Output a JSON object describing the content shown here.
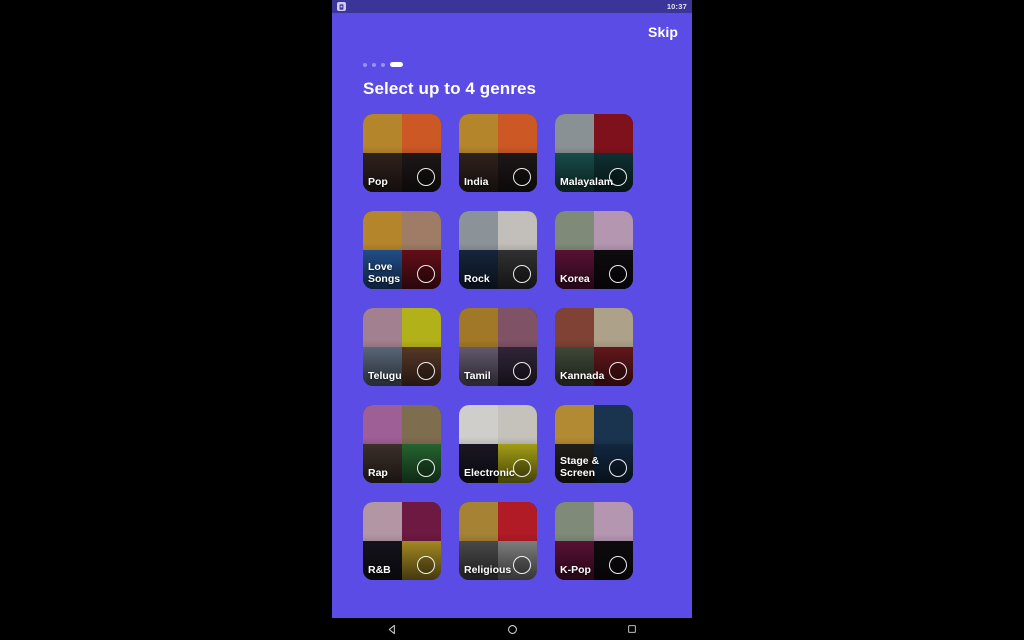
{
  "status_bar": {
    "app_icon": "app-notification-icon",
    "time": "10:37",
    "background_color": "#3B3499"
  },
  "header": {
    "skip_label": "Skip",
    "title": "Select up to 4 genres"
  },
  "pagination": {
    "total": 4,
    "active_index": 3
  },
  "theme": {
    "background_color": "#5B4CE6",
    "text_color": "#FFFFFF"
  },
  "genres": [
    {
      "label": "Pop",
      "selected": false,
      "tiles": [
        "#C9952F",
        "#E2622A",
        "#3A2A24",
        "#241C1E"
      ]
    },
    {
      "label": "India",
      "selected": false,
      "tiles": [
        "#C9952F",
        "#E2622A",
        "#3A2A24",
        "#241C1E"
      ]
    },
    {
      "label": "Malayalam",
      "selected": false,
      "tiles": [
        "#9AA2A6",
        "#8E1420",
        "#1E5E5A",
        "#123C3E"
      ]
    },
    {
      "label": "Love Songs",
      "selected": false,
      "tiles": [
        "#C9952F",
        "#B08B72",
        "#2A5FA8",
        "#7A1220"
      ]
    },
    {
      "label": "Rock",
      "selected": false,
      "tiles": [
        "#9BA3AA",
        "#D8D4CE",
        "#1B2E4A",
        "#3C3C3C"
      ]
    },
    {
      "label": "Korea",
      "selected": false,
      "tiles": [
        "#8E9A86",
        "#C9A7C6",
        "#6D1640",
        "#120E14"
      ]
    },
    {
      "label": "Telugu",
      "selected": false,
      "tiles": [
        "#B58FA0",
        "#C8C61E",
        "#6E7E92",
        "#6A4430"
      ]
    },
    {
      "label": "Tamil",
      "selected": false,
      "tiles": [
        "#B4862C",
        "#8E5C72",
        "#7A6E86",
        "#3C2E44"
      ]
    },
    {
      "label": "Kannada",
      "selected": false,
      "tiles": [
        "#8E4A3A",
        "#C2B49A",
        "#4E5A46",
        "#7A1C22"
      ]
    },
    {
      "label": "Rap",
      "selected": false,
      "tiles": [
        "#B06AA8",
        "#8E7A58",
        "#4A3A34",
        "#2E7A3A"
      ]
    },
    {
      "label": "Electronic",
      "selected": false,
      "tiles": [
        "#E8E6E2",
        "#DCD8D2",
        "#201C2A",
        "#C8C21A"
      ]
    },
    {
      "label": "Stage & Screen",
      "selected": false,
      "tiles": [
        "#C89A3A",
        "#1E3A5A",
        "#2A2620",
        "#16304E"
      ]
    },
    {
      "label": "R&B",
      "selected": false,
      "tiles": [
        "#C8A8B6",
        "#7A1C4A",
        "#1A1824",
        "#C8A82A"
      ]
    },
    {
      "label": "Religious",
      "selected": false,
      "tiles": [
        "#B8913A",
        "#C41F2A",
        "#5A5A5A",
        "#9A9A9A"
      ]
    },
    {
      "label": "K-Pop",
      "selected": false,
      "tiles": [
        "#8E9A86",
        "#C9A7C6",
        "#6D1640",
        "#120E14"
      ]
    }
  ],
  "nav_bar": {
    "back_icon": "back-triangle-icon",
    "home_icon": "home-circle-icon",
    "recents_icon": "recents-square-icon"
  }
}
